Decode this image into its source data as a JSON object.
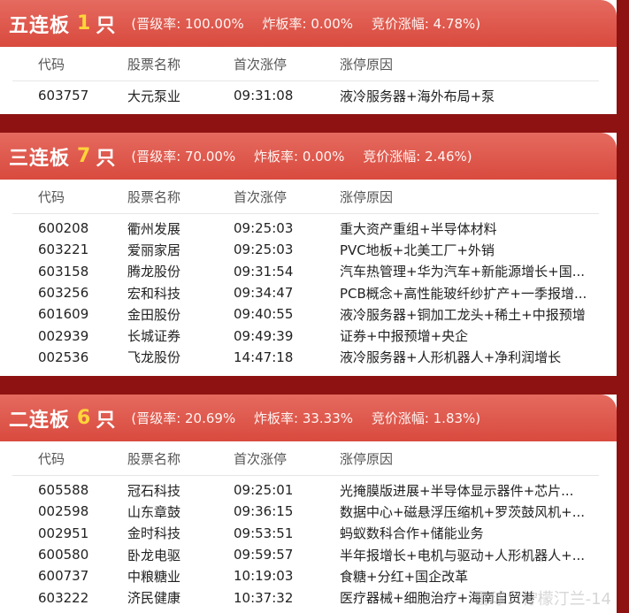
{
  "boards": [
    {
      "name": "五连板",
      "count": "1",
      "unit": "只",
      "stats": [
        "(晋级率: 100.00%",
        "炸板率: 0.00%",
        "竞价涨幅: 4.78%)"
      ],
      "headers": [
        "代码",
        "股票名称",
        "首次涨停",
        "涨停原因"
      ],
      "rows": [
        {
          "code": "603757",
          "name": "大元泵业",
          "time": "09:31:08",
          "reason": "液冷服务器+海外布局+泵"
        }
      ]
    },
    {
      "name": "三连板",
      "count": "7",
      "unit": "只",
      "stats": [
        "(晋级率: 70.00%",
        "炸板率: 0.00%",
        "竞价涨幅: 2.46%)"
      ],
      "headers": [
        "代码",
        "股票名称",
        "首次涨停",
        "涨停原因"
      ],
      "rows": [
        {
          "code": "600208",
          "name": "衢州发展",
          "time": "09:25:03",
          "reason": "重大资产重组+半导体材料"
        },
        {
          "code": "603221",
          "name": "爱丽家居",
          "time": "09:25:03",
          "reason": "PVC地板+北美工厂+外销"
        },
        {
          "code": "603158",
          "name": "腾龙股份",
          "time": "09:31:54",
          "reason": "汽车热管理+华为汽车+新能源增长+国..."
        },
        {
          "code": "603256",
          "name": "宏和科技",
          "time": "09:34:47",
          "reason": "PCB概念+高性能玻纤纱扩产+一季报增..."
        },
        {
          "code": "601609",
          "name": "金田股份",
          "time": "09:40:55",
          "reason": "液冷服务器+铜加工龙头+稀土+中报预增"
        },
        {
          "code": "002939",
          "name": "长城证券",
          "time": "09:49:39",
          "reason": "证券+中报预增+央企"
        },
        {
          "code": "002536",
          "name": "飞龙股份",
          "time": "14:47:18",
          "reason": "液冷服务器+人形机器人+净利润增长"
        }
      ]
    },
    {
      "name": "二连板",
      "count": "6",
      "unit": "只",
      "stats": [
        "(晋级率: 20.69%",
        "炸板率: 33.33%",
        "竞价涨幅: 1.83%)"
      ],
      "headers": [
        "代码",
        "股票名称",
        "首次涨停",
        "涨停原因"
      ],
      "rows": [
        {
          "code": "605588",
          "name": "冠石科技",
          "time": "09:25:01",
          "reason": "光掩膜版进展+半导体显示器件+芯片..."
        },
        {
          "code": "002598",
          "name": "山东章鼓",
          "time": "09:36:15",
          "reason": "数据中心+磁悬浮压缩机+罗茨鼓风机+..."
        },
        {
          "code": "002951",
          "name": "金时科技",
          "time": "09:53:51",
          "reason": "蚂蚁数科合作+储能业务"
        },
        {
          "code": "600580",
          "name": "卧龙电驱",
          "time": "09:59:57",
          "reason": "半年报增长+电机与驱动+人形机器人+..."
        },
        {
          "code": "600737",
          "name": "中粮糖业",
          "time": "10:19:03",
          "reason": "食糖+分红+国企改革"
        },
        {
          "code": "603222",
          "name": "济民健康",
          "time": "10:37:32",
          "reason": "医疗器械+细胞治疗+海南自贸港"
        }
      ]
    }
  ],
  "footer_watermark": "雪球：柠檬汀兰-14"
}
